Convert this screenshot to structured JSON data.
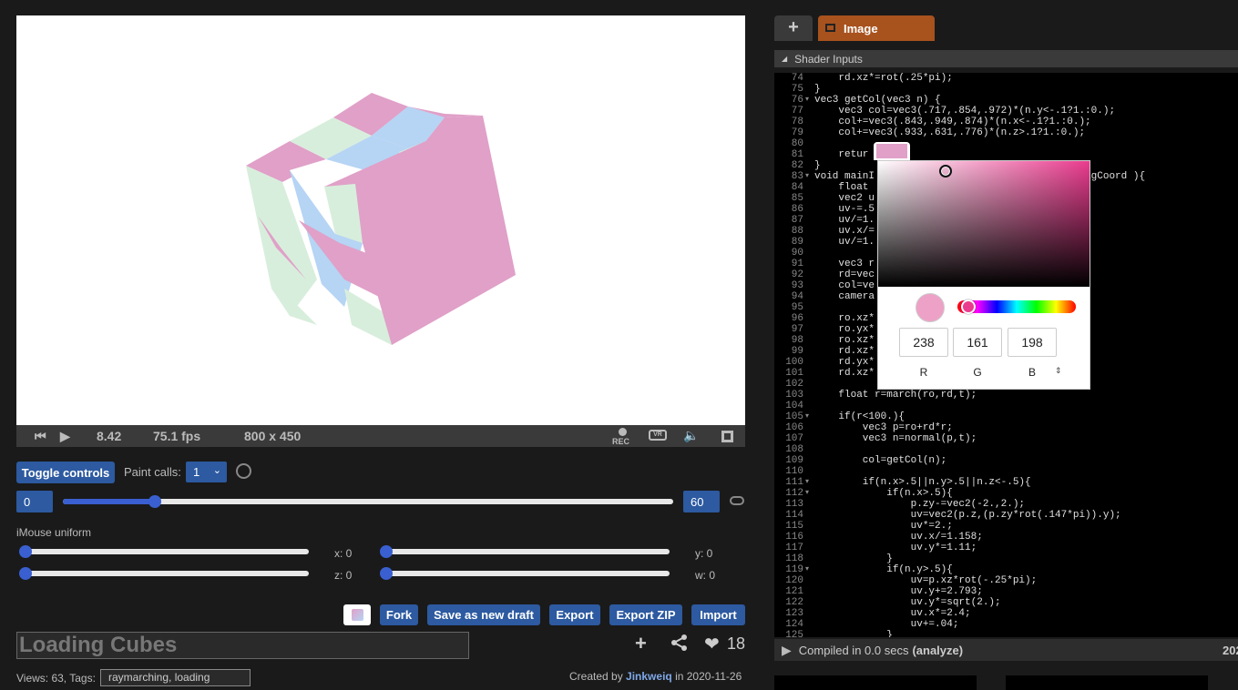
{
  "player": {
    "time": "8.42",
    "fps": "75.1 fps",
    "resolution": "800 x 450",
    "rec_label": "REC"
  },
  "controls": {
    "toggle_label": "Toggle controls",
    "paint_calls_label": "Paint calls:",
    "paint_calls_value": "1",
    "range_start": "0",
    "range_end": "60",
    "range_fraction": 0.15,
    "imouse_label": "iMouse uniform",
    "x_label": "x: 0",
    "y_label": "y: 0",
    "z_label": "z: 0",
    "w_label": "w: 0"
  },
  "actions": {
    "fork": "Fork",
    "save_draft": "Save as new draft",
    "export": "Export",
    "export_zip": "Export ZIP",
    "import": "Import"
  },
  "shader": {
    "title": "Loading Cubes",
    "likes": "18",
    "views_text": "Views: 63, Tags:",
    "tags": "raymarching, loading",
    "created_prefix": "Created by",
    "author": "Jinkweiq",
    "created_suffix": "in 2020-11-26"
  },
  "editor": {
    "add_tab": "+",
    "tab_label": "Image",
    "shader_inputs_label": "Shader Inputs",
    "compiled_text": "Compiled in 0.0 secs",
    "analyze_text": "(analyze)",
    "compiled_right": "202",
    "code_lines": [
      {
        "n": "74",
        "f": "",
        "t": "    rd.xz*=rot(.25*pi);"
      },
      {
        "n": "75",
        "f": "",
        "t": "}"
      },
      {
        "n": "76",
        "f": "▾",
        "t": "vec3 getCol(vec3 n) {"
      },
      {
        "n": "77",
        "f": "",
        "t": "    vec3 col=vec3(.717,.854,.972)*(n.y<-.1?1.:0.);"
      },
      {
        "n": "78",
        "f": "",
        "t": "    col+=vec3(.843,.949,.874)*(n.x<-.1?1.:0.);"
      },
      {
        "n": "79",
        "f": "",
        "t": "    col+=vec3(.933,.631,.776)*(n.z>.1?1.:0.);"
      },
      {
        "n": "80",
        "f": "",
        "t": ""
      },
      {
        "n": "81",
        "f": "",
        "t": "    retur"
      },
      {
        "n": "82",
        "f": "",
        "t": "}"
      },
      {
        "n": "83",
        "f": "▾",
        "t": "void mainI                               2 fragCoord ){"
      },
      {
        "n": "84",
        "f": "",
        "t": "    float"
      },
      {
        "n": "85",
        "f": "",
        "t": "    vec2 u"
      },
      {
        "n": "86",
        "f": "",
        "t": "    uv-=.5"
      },
      {
        "n": "87",
        "f": "",
        "t": "    uv/=1."
      },
      {
        "n": "88",
        "f": "",
        "t": "    uv.x/="
      },
      {
        "n": "89",
        "f": "",
        "t": "    uv/=1."
      },
      {
        "n": "90",
        "f": "",
        "t": ""
      },
      {
        "n": "91",
        "f": "",
        "t": "    vec3 r"
      },
      {
        "n": "92",
        "f": "",
        "t": "    rd=vec"
      },
      {
        "n": "93",
        "f": "",
        "t": "    col=ve"
      },
      {
        "n": "94",
        "f": "",
        "t": "    camera"
      },
      {
        "n": "95",
        "f": "",
        "t": ""
      },
      {
        "n": "96",
        "f": "",
        "t": "    ro.xz*"
      },
      {
        "n": "97",
        "f": "",
        "t": "    ro.yx*"
      },
      {
        "n": "98",
        "f": "",
        "t": "    ro.xz*"
      },
      {
        "n": "99",
        "f": "",
        "t": "    rd.xz*"
      },
      {
        "n": "100",
        "f": "",
        "t": "    rd.yx*"
      },
      {
        "n": "101",
        "f": "",
        "t": "    rd.xz*"
      },
      {
        "n": "102",
        "f": "",
        "t": ""
      },
      {
        "n": "103",
        "f": "",
        "t": "    float r=march(ro,rd,t);"
      },
      {
        "n": "104",
        "f": "",
        "t": ""
      },
      {
        "n": "105",
        "f": "▾",
        "t": "    if(r<100.){"
      },
      {
        "n": "106",
        "f": "",
        "t": "        vec3 p=ro+rd*r;"
      },
      {
        "n": "107",
        "f": "",
        "t": "        vec3 n=normal(p,t);"
      },
      {
        "n": "108",
        "f": "",
        "t": ""
      },
      {
        "n": "109",
        "f": "",
        "t": "        col=getCol(n);"
      },
      {
        "n": "110",
        "f": "",
        "t": ""
      },
      {
        "n": "111",
        "f": "▾",
        "t": "        if(n.x>.5||n.y>.5||n.z<-.5){"
      },
      {
        "n": "112",
        "f": "▾",
        "t": "            if(n.x>.5){"
      },
      {
        "n": "113",
        "f": "",
        "t": "                p.zy-=vec2(-2.,2.);"
      },
      {
        "n": "114",
        "f": "",
        "t": "                uv=vec2(p.z,(p.zy*rot(.147*pi)).y);"
      },
      {
        "n": "115",
        "f": "",
        "t": "                uv*=2.;"
      },
      {
        "n": "116",
        "f": "",
        "t": "                uv.x/=1.158;"
      },
      {
        "n": "117",
        "f": "",
        "t": "                uv.y*=1.11;"
      },
      {
        "n": "118",
        "f": "",
        "t": "            }"
      },
      {
        "n": "119",
        "f": "▾",
        "t": "            if(n.y>.5){"
      },
      {
        "n": "120",
        "f": "",
        "t": "                uv=p.xz*rot(-.25*pi);"
      },
      {
        "n": "121",
        "f": "",
        "t": "                uv.y+=2.793;"
      },
      {
        "n": "122",
        "f": "",
        "t": "                uv.y*=sqrt(2.);"
      },
      {
        "n": "123",
        "f": "",
        "t": "                uv.x*=2.4;"
      },
      {
        "n": "124",
        "f": "",
        "t": "                uv+=.04;"
      },
      {
        "n": "125",
        "f": "",
        "t": "            }"
      }
    ]
  },
  "color_picker": {
    "r": "238",
    "g": "161",
    "b": "198",
    "r_label": "R",
    "g_label": "G",
    "b_label": "B",
    "color": "#eea1c6",
    "hue_fraction": 0.09
  },
  "colors": {
    "accent_blue": "#2d5aa0",
    "tab_orange": "#a8521e",
    "cube_pink": "#e0a0c8",
    "cube_green": "#d8eedc",
    "cube_blue": "#b6d4f4"
  }
}
